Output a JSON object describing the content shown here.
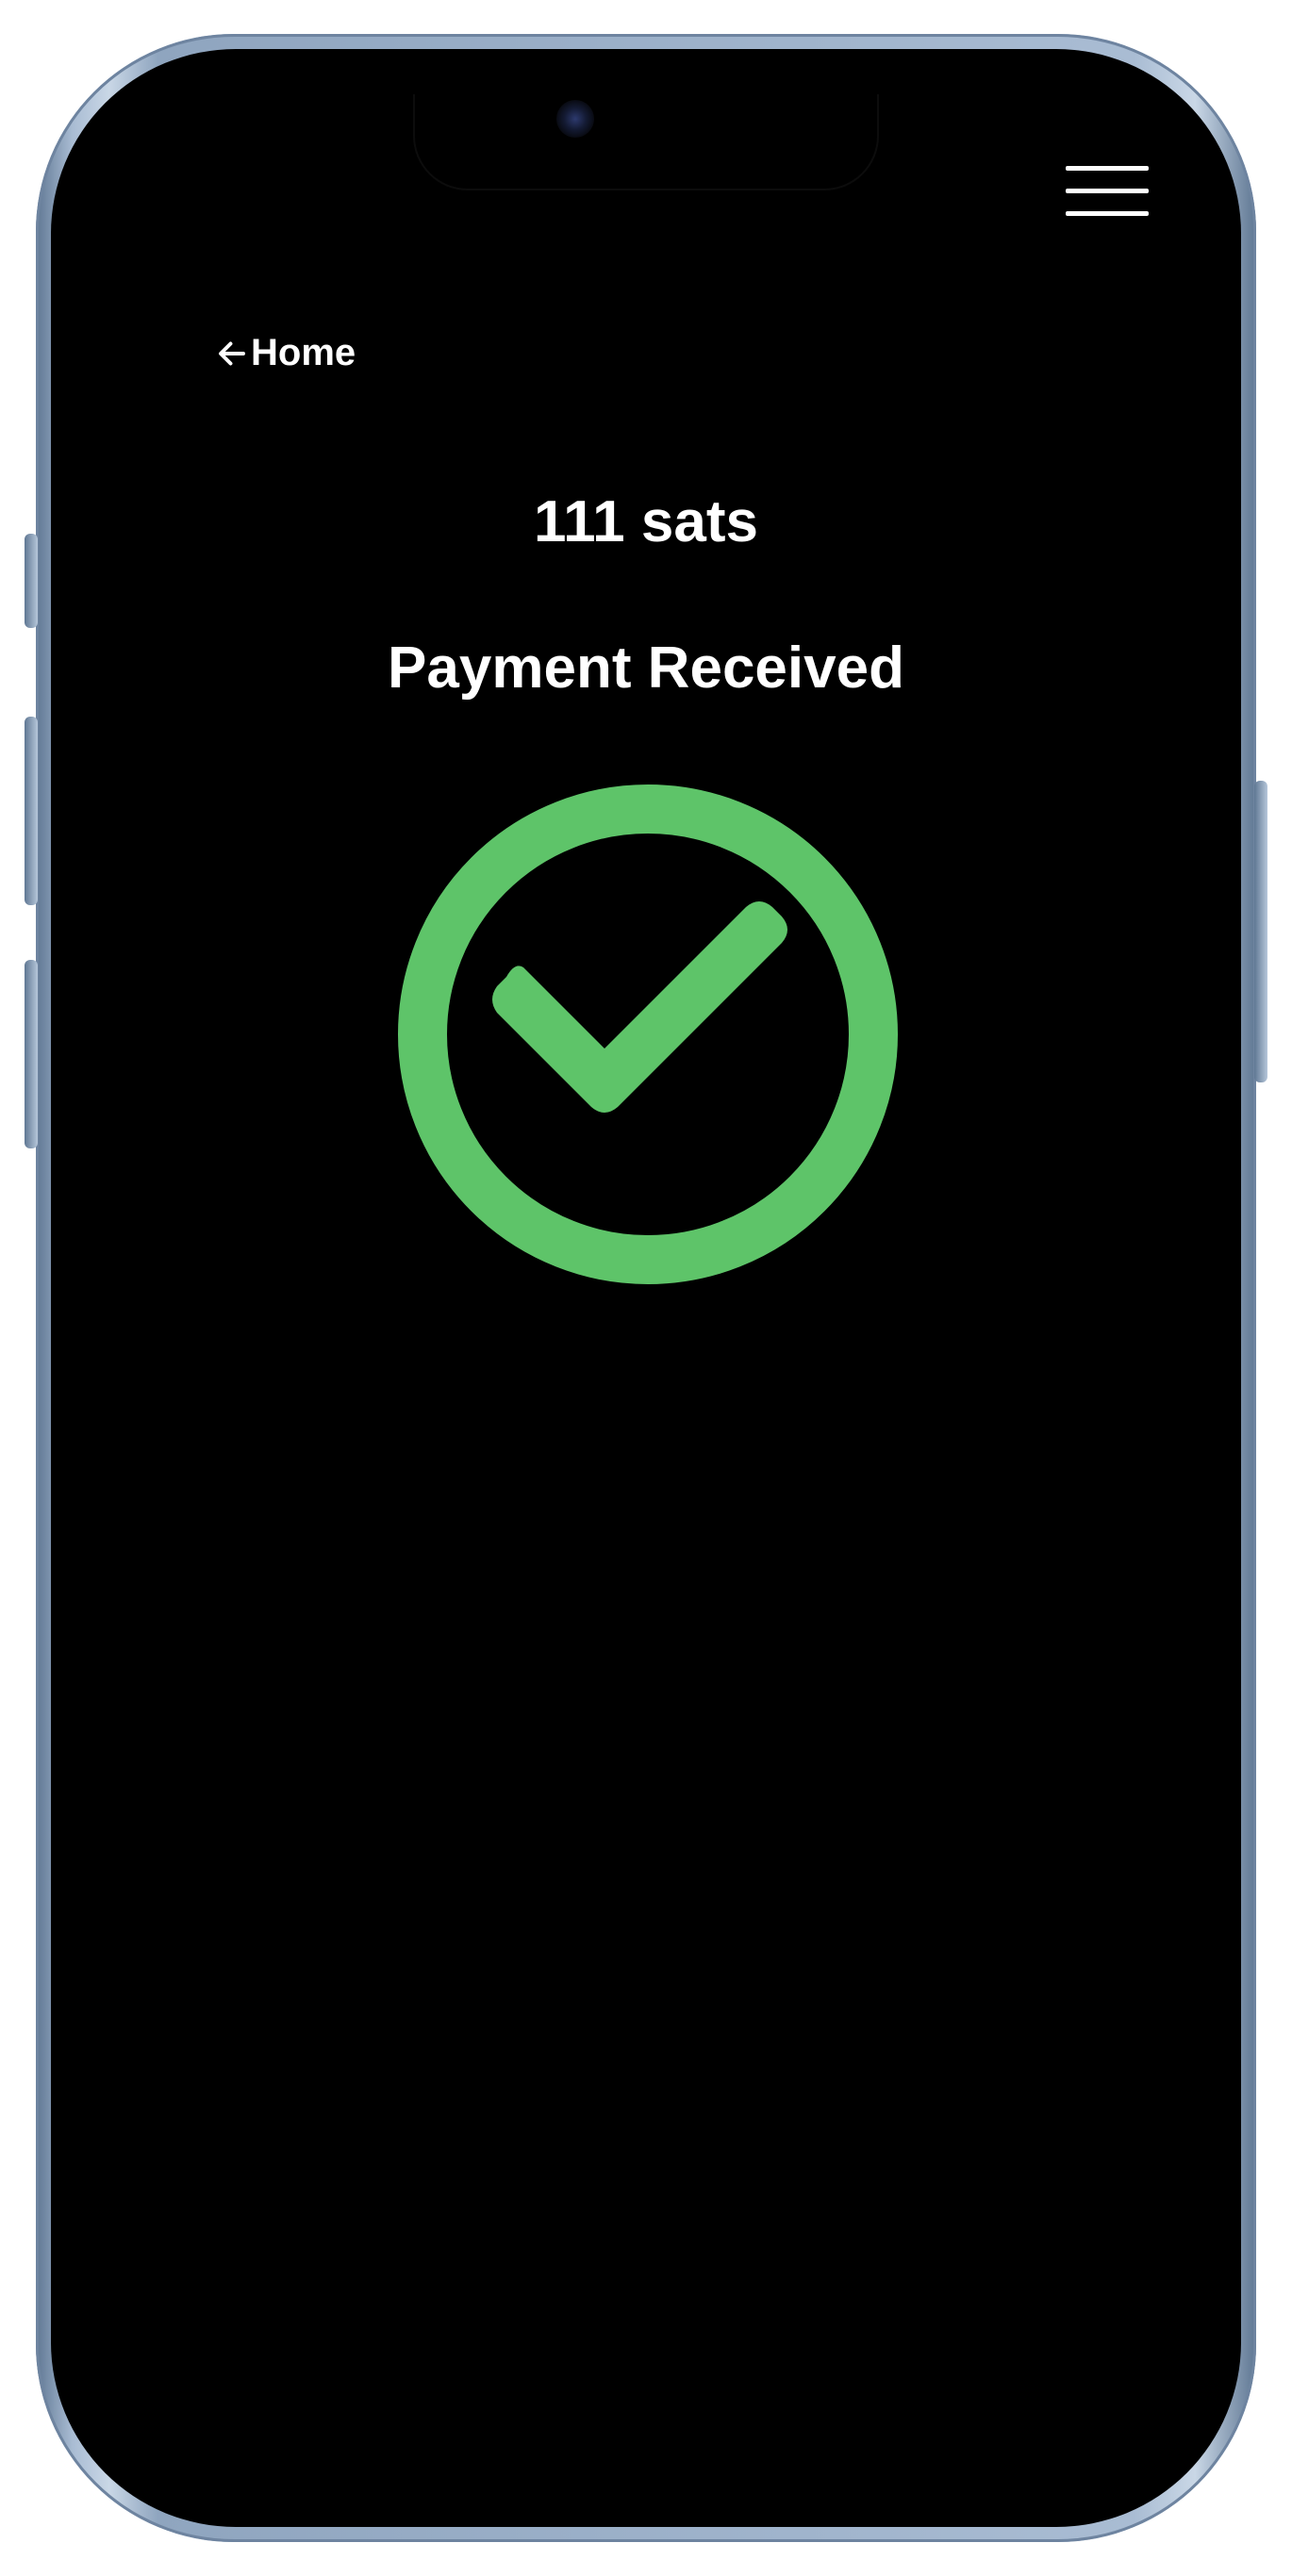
{
  "nav": {
    "back_label": "Home",
    "menu_icon": "hamburger-menu-icon",
    "back_icon": "arrow-left-icon"
  },
  "payment": {
    "amount": "111 sats",
    "status": "Payment Received",
    "status_icon": "check-circle-icon"
  },
  "colors": {
    "background": "#000000",
    "text": "#ffffff",
    "success": "#5ec469"
  }
}
